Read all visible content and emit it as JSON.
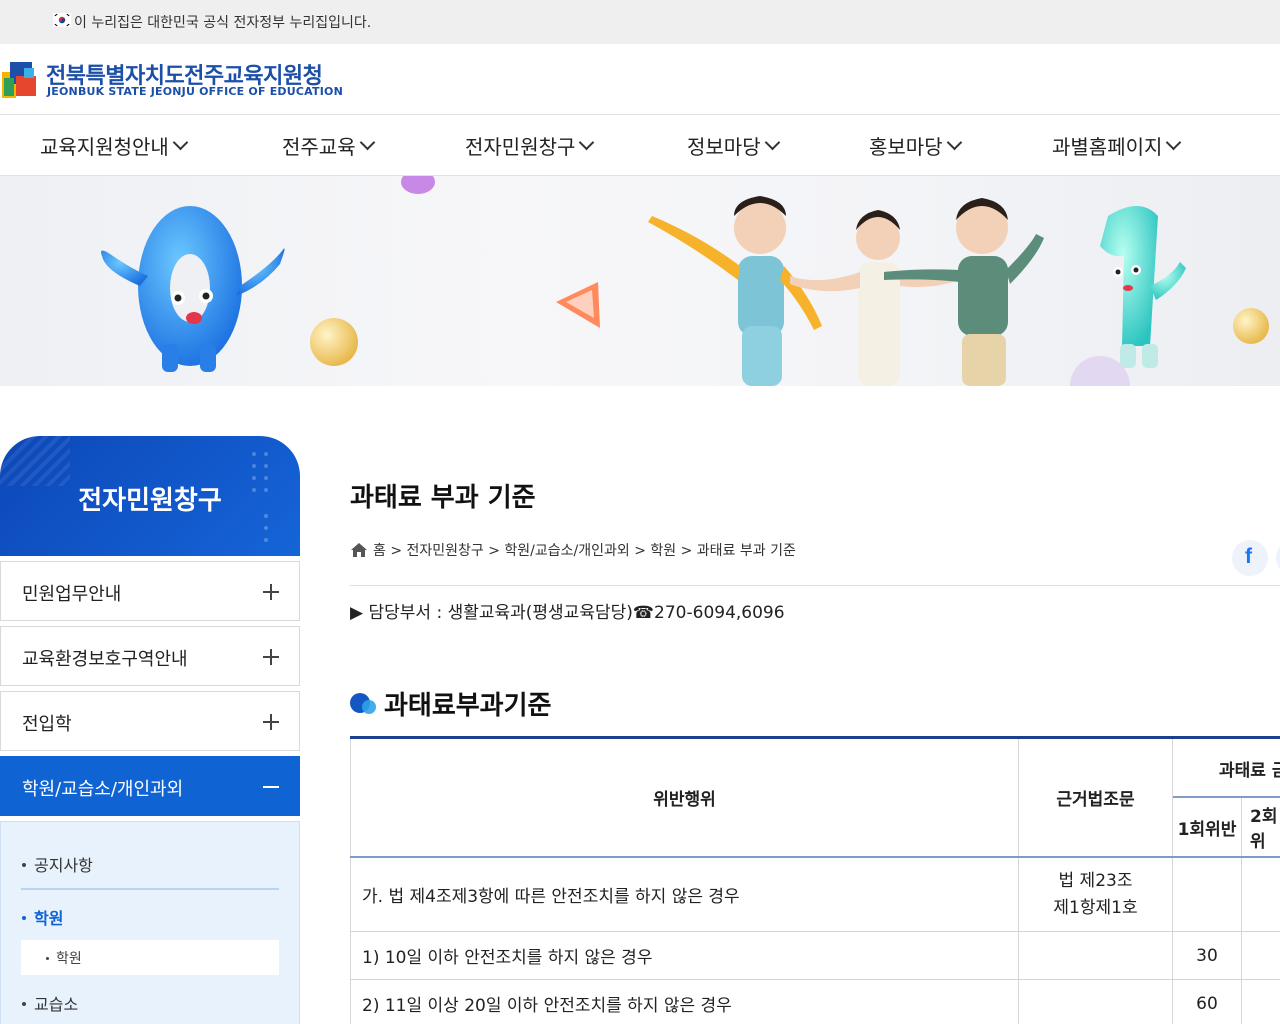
{
  "gov_notice": "이 누리집은 대한민국 공식 전자정부 누리집입니다.",
  "header": {
    "logo_title": "전북특별자치도전주교육지원청",
    "logo_subtitle": "JEONBUK STATE JEONJU OFFICE OF EDUCATION"
  },
  "gnb": [
    "교육지원청안내",
    "전주교육",
    "전자민원창구",
    "정보마당",
    "홍보마당",
    "과별홈페이지"
  ],
  "sidebar": {
    "title": "전자민원창구",
    "menus": [
      "민원업무안내",
      "교육환경보호구역안내",
      "전입학",
      "학원/교습소/개인과외"
    ],
    "sub_items": [
      "공지사항",
      "학원",
      "교습소"
    ],
    "sub_sub_item": "학원"
  },
  "page": {
    "title": "과태료 부과 기준",
    "breadcrumb": "홈 > 전자민원창구 > 학원/교습소/개인과외 > 학원 > 과태료 부과 기준",
    "dept": "▶ 담당부서 : 생활교육과(평생교육담당)☎270-6094,6096",
    "section_title": "과태료부과기준"
  },
  "table": {
    "headers": {
      "violation": "위반행위",
      "law": "근거법조문",
      "fine": "과태료 금",
      "first": "1회위반",
      "second": "2회위"
    },
    "rows": [
      {
        "violation": "가. 법 제4조제3항에 따른 안전조치를 하지 않은 경우",
        "law": "법 제23조\n제1항제1호",
        "first": ""
      },
      {
        "violation": "1) 10일 이하 안전조치를 하지 않은 경우",
        "law": "",
        "first": "30"
      },
      {
        "violation": "2) 11일 이상 20일 이하 안전조치를 하지 않은 경우",
        "law": "",
        "first": "60"
      }
    ]
  },
  "colors": {
    "primary": "#0f63d3",
    "sidebar_head": "#0d47b8",
    "logo_blue": "#1b4fa8",
    "table_border": "#1d3f8e"
  }
}
